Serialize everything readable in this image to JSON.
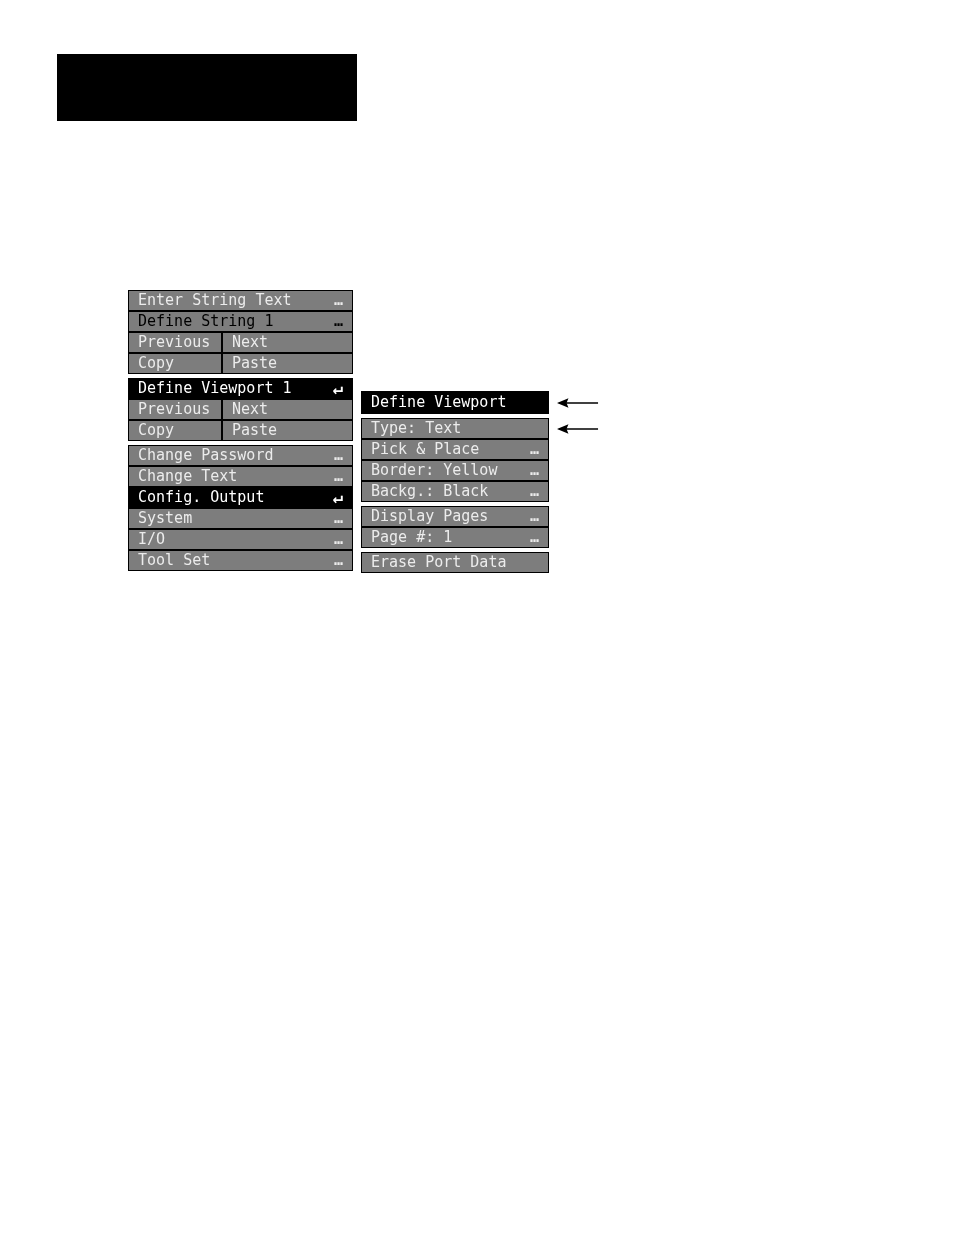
{
  "left_menu": {
    "groups": [
      {
        "rows": [
          {
            "kind": "item",
            "label": "Enter String Text",
            "suffix": "…",
            "selected": false,
            "disabled": false
          },
          {
            "kind": "item",
            "label": "Define String 1",
            "suffix": "…",
            "selected": false,
            "disabled": true
          },
          {
            "kind": "pair",
            "cells": [
              "Previous",
              "Next"
            ]
          },
          {
            "kind": "pair",
            "cells": [
              "Copy",
              "Paste"
            ]
          }
        ]
      },
      {
        "rows": [
          {
            "kind": "item",
            "label": "Define Viewport 1",
            "suffix": "↵",
            "selected": true,
            "disabled": false
          },
          {
            "kind": "pair",
            "cells": [
              "Previous",
              "Next"
            ]
          },
          {
            "kind": "pair",
            "cells": [
              "Copy",
              "Paste"
            ]
          }
        ]
      },
      {
        "rows": [
          {
            "kind": "item",
            "label": "Change Password",
            "suffix": "…",
            "selected": false,
            "disabled": false
          },
          {
            "kind": "item",
            "label": "Change Text",
            "suffix": "…",
            "selected": false,
            "disabled": false
          },
          {
            "kind": "item",
            "label": "Config. Output",
            "suffix": "↵",
            "selected": true,
            "disabled": false
          },
          {
            "kind": "item",
            "label": "System",
            "suffix": "…",
            "selected": false,
            "disabled": false
          },
          {
            "kind": "item",
            "label": "I/O",
            "suffix": "…",
            "selected": false,
            "disabled": false
          },
          {
            "kind": "item",
            "label": "Tool Set",
            "suffix": "…",
            "selected": false,
            "disabled": false
          }
        ]
      }
    ]
  },
  "right_menu": {
    "groups": [
      {
        "rows": [
          {
            "kind": "item",
            "label": "Define Viewport",
            "selected": true,
            "disabled": false,
            "pointer": true
          }
        ]
      },
      {
        "rows": [
          {
            "kind": "item",
            "label": "Type: Text",
            "selected": false,
            "disabled": false,
            "pointer": true
          },
          {
            "kind": "item",
            "label": "Pick & Place",
            "suffix": "…",
            "selected": false,
            "disabled": false,
            "pointer": false
          },
          {
            "kind": "item",
            "label": "Border: Yellow",
            "suffix": "…",
            "selected": false,
            "disabled": false,
            "pointer": false
          },
          {
            "kind": "item",
            "label": "Backg.: Black",
            "suffix": "…",
            "selected": false,
            "disabled": false,
            "pointer": false
          }
        ]
      },
      {
        "rows": [
          {
            "kind": "item",
            "label": "Display Pages",
            "suffix": "…",
            "selected": false,
            "disabled": false,
            "pointer": false
          },
          {
            "kind": "item",
            "label": "Page #: 1",
            "suffix": "…",
            "selected": false,
            "disabled": false,
            "pointer": false
          }
        ]
      },
      {
        "rows": [
          {
            "kind": "item",
            "label": "Erase Port Data",
            "selected": false,
            "disabled": false,
            "pointer": false
          }
        ]
      }
    ]
  }
}
